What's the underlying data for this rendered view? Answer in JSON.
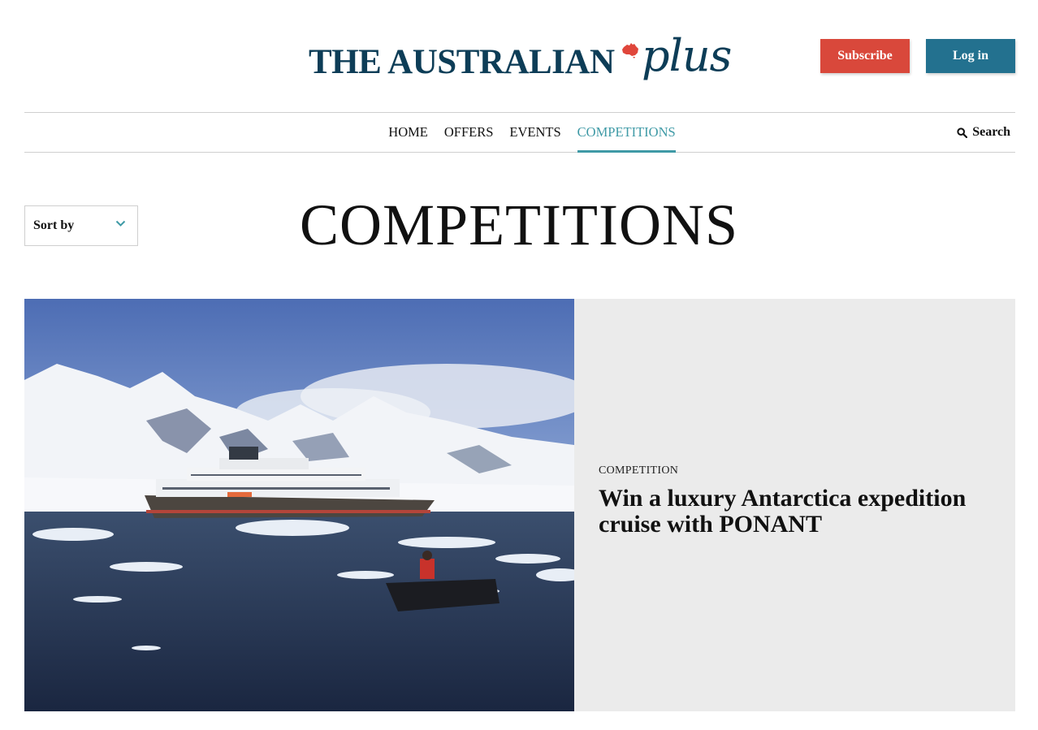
{
  "header": {
    "logo_text": "THE AUSTRALIAN",
    "logo_suffix": "plus",
    "subscribe_label": "Subscribe",
    "login_label": "Log in"
  },
  "nav": {
    "items": [
      {
        "label": "HOME"
      },
      {
        "label": "OFFERS"
      },
      {
        "label": "EVENTS"
      },
      {
        "label": "COMPETITIONS",
        "active": true
      }
    ],
    "search_label": "Search"
  },
  "sort": {
    "label": "Sort by"
  },
  "page": {
    "title": "COMPETITIONS"
  },
  "card": {
    "category": "COMPETITION",
    "title": "Win a luxury Antarctica expedition cruise with PONANT"
  },
  "colors": {
    "brand_navy": "#0d3d57",
    "subscribe_red": "#d9483b",
    "login_teal": "#23718f",
    "nav_active": "#3f9aa6",
    "card_bg": "#ebebeb"
  },
  "icons": [
    "australia-map-icon",
    "search-icon",
    "chevron-down-icon"
  ]
}
